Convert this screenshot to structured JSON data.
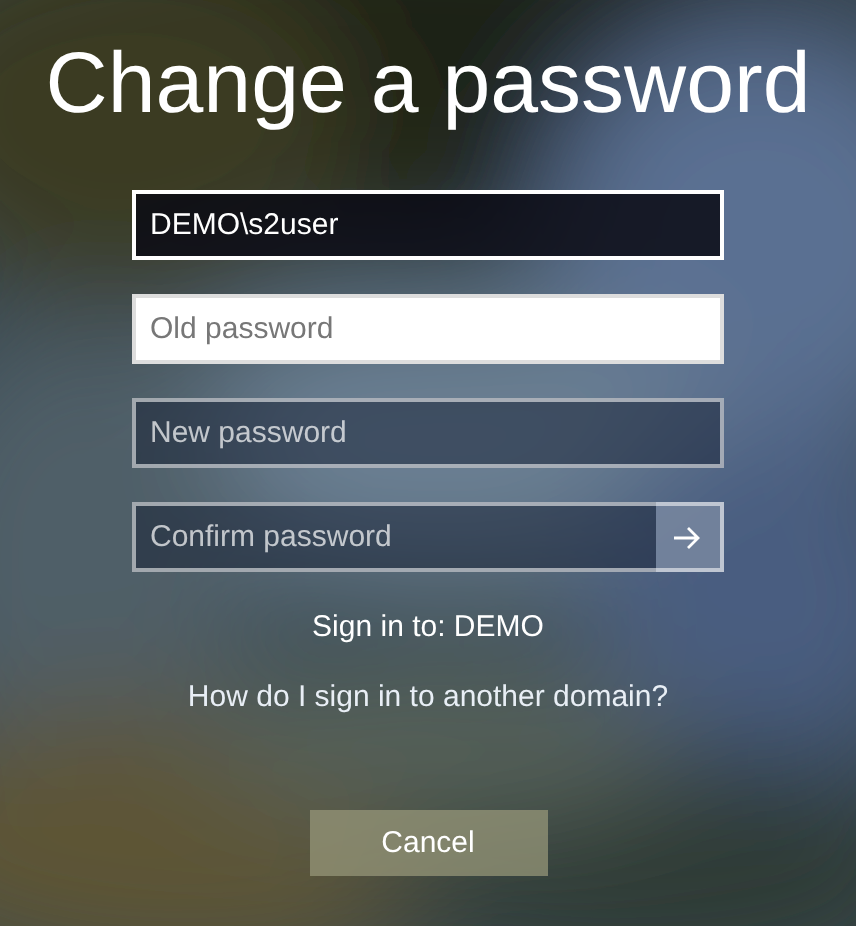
{
  "title": "Change a password",
  "fields": [
    {
      "kind": "filled",
      "value": "DEMO\\s2user",
      "submit": false
    },
    {
      "kind": "active",
      "placeholder": "Old password",
      "submit": false
    },
    {
      "kind": "blank",
      "placeholder": "New password",
      "submit": false
    },
    {
      "kind": "blank",
      "placeholder": "Confirm password",
      "submit": true
    }
  ],
  "sign_in_to": "Sign in to: DEMO",
  "help_link": "How do I sign in to another domain?",
  "cancel_button": "Cancel"
}
